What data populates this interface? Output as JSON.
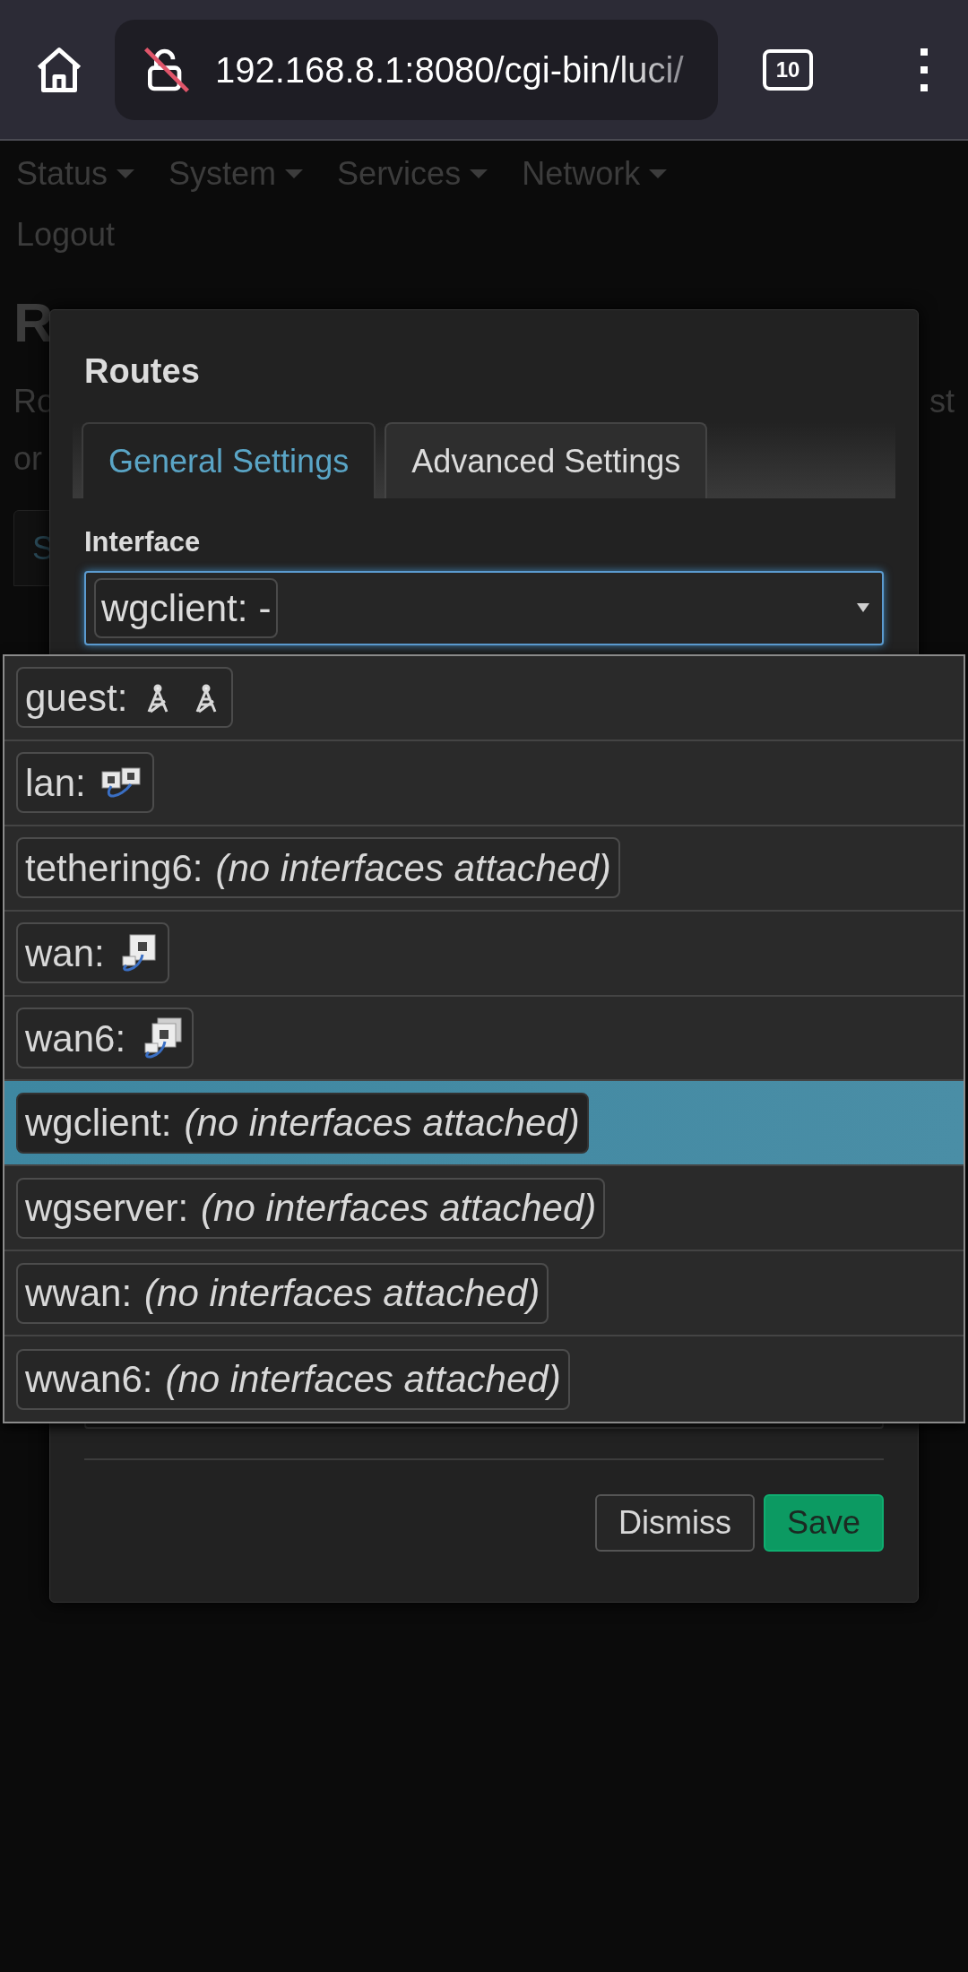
{
  "browser": {
    "url": "192.168.8.1:8080/cgi-bin/luci/",
    "tab_count": "10"
  },
  "nav": [
    {
      "label": "Status",
      "dropdown": true
    },
    {
      "label": "System",
      "dropdown": true
    },
    {
      "label": "Services",
      "dropdown": true
    },
    {
      "label": "Network",
      "dropdown": true
    },
    {
      "label": "Logout",
      "dropdown": false
    }
  ],
  "background_page": {
    "heading": "R",
    "description_start": "Ro",
    "description_end": "st",
    "description_line2": "or",
    "tab": "S"
  },
  "dialog": {
    "title": "Routes",
    "tabs": [
      {
        "label": "General Settings",
        "selected": true
      },
      {
        "label": "Advanced Settings",
        "selected": false
      }
    ],
    "interface": {
      "label": "Interface",
      "value": {
        "name": "wgclient:",
        "status": "-"
      },
      "options": [
        {
          "name": "guest:",
          "selected": false,
          "devices": [
            {
              "kind": "wireless"
            },
            {
              "kind": "wireless"
            }
          ]
        },
        {
          "name": "lan:",
          "selected": false,
          "devices": [
            {
              "kind": "switch"
            }
          ]
        },
        {
          "name": "tethering6:",
          "selected": false,
          "status": "(no interfaces attached)"
        },
        {
          "name": "wan:",
          "selected": false,
          "devices": [
            {
              "kind": "ethernet"
            }
          ]
        },
        {
          "name": "wan6:",
          "selected": false,
          "devices": [
            {
              "kind": "ethernet-stack"
            }
          ]
        },
        {
          "name": "wgclient:",
          "selected": true,
          "status": "(no interfaces attached)"
        },
        {
          "name": "wgserver:",
          "selected": false,
          "status": "(no interfaces attached)"
        },
        {
          "name": "wwan:",
          "selected": false,
          "status": "(no interfaces attached)"
        },
        {
          "name": "wwan6:",
          "selected": false,
          "status": "(no interfaces attached)"
        }
      ]
    },
    "buttons": [
      {
        "label": "Dismiss",
        "kind": "neutral"
      },
      {
        "label": "Save",
        "kind": "primary"
      }
    ]
  }
}
